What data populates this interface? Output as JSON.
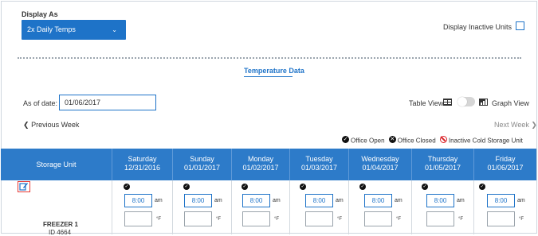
{
  "filters": {
    "display_as_label": "Display As",
    "display_as_value": "2x Daily Temps",
    "display_inactive_label": "Display Inactive Units"
  },
  "tab": {
    "label": "Temperature Data"
  },
  "date": {
    "label": "As of date:",
    "value": "01/06/2017"
  },
  "view": {
    "table_label": "Table View",
    "graph_label": "Graph View"
  },
  "nav": {
    "previous": "Previous Week",
    "next": "Next Week"
  },
  "legend": {
    "open": "Office Open",
    "closed": "Office Closed",
    "inactive": "Inactive Cold Storage Unit"
  },
  "table": {
    "first_header": "Storage Unit",
    "days": [
      {
        "day": "Saturday",
        "date": "12/31/2016"
      },
      {
        "day": "Sunday",
        "date": "01/01/2017"
      },
      {
        "day": "Monday",
        "date": "01/02/2017"
      },
      {
        "day": "Tuesday",
        "date": "01/03/2017"
      },
      {
        "day": "Wednesday",
        "date": "01/04/2017"
      },
      {
        "day": "Thursday",
        "date": "01/05/2017"
      },
      {
        "day": "Friday",
        "date": "01/06/2017"
      }
    ],
    "row": {
      "unit_name": "FREEZER 1",
      "unit_id": "ID 4664",
      "time": "8:00",
      "ampm": "am",
      "unit_symbol": "°F"
    }
  },
  "colors": {
    "accent": "#1e73c8",
    "header": "#2d7bc9",
    "closed": "#d9242a",
    "edit_border": "#e53935"
  }
}
